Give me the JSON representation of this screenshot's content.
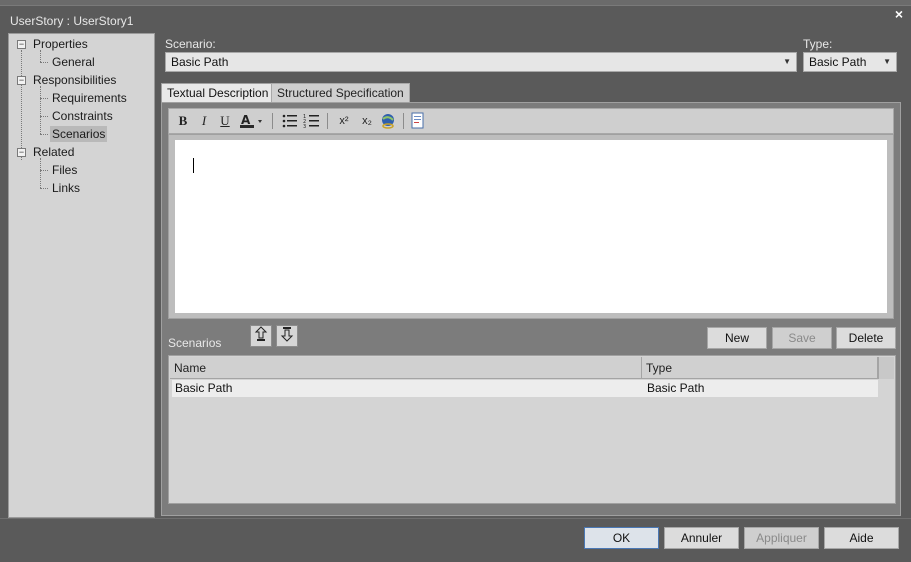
{
  "window": {
    "title": "UserStory : UserStory1",
    "close_glyph": "×"
  },
  "tree": {
    "items": [
      {
        "label": "Properties",
        "level": 0,
        "expanded": true
      },
      {
        "label": "General",
        "level": 1
      },
      {
        "label": "Responsibilities",
        "level": 0,
        "expanded": true
      },
      {
        "label": "Requirements",
        "level": 1
      },
      {
        "label": "Constraints",
        "level": 1
      },
      {
        "label": "Scenarios",
        "level": 1,
        "selected": true
      },
      {
        "label": "Related",
        "level": 0,
        "expanded": true
      },
      {
        "label": "Files",
        "level": 1
      },
      {
        "label": "Links",
        "level": 1
      }
    ]
  },
  "scenario": {
    "label": "Scenario:",
    "value": "Basic Path"
  },
  "type": {
    "label": "Type:",
    "value": "Basic Path"
  },
  "tabs": [
    {
      "label": "Textual Description",
      "active": true
    },
    {
      "label": "Structured Specification",
      "active": false
    }
  ],
  "toolbar": {
    "bold": "B",
    "italic": "I",
    "underline": "U",
    "superscript": "x²",
    "subscript": "x₂"
  },
  "scenarios_panel": {
    "label": "Scenarios",
    "new_label": "New",
    "save_label": "Save",
    "delete_label": "Delete",
    "columns": [
      "Name",
      "Type"
    ],
    "rows": [
      {
        "name": "Basic Path",
        "type": "Basic Path"
      }
    ]
  },
  "footer": {
    "ok_label": "OK",
    "cancel_label": "Annuler",
    "apply_label": "Appliquer",
    "help_label": "Aide"
  },
  "colors": {
    "window_bg": "#5a5a5a",
    "panel_bg": "#d4d4d4",
    "accent_border": "#4a78b5"
  }
}
